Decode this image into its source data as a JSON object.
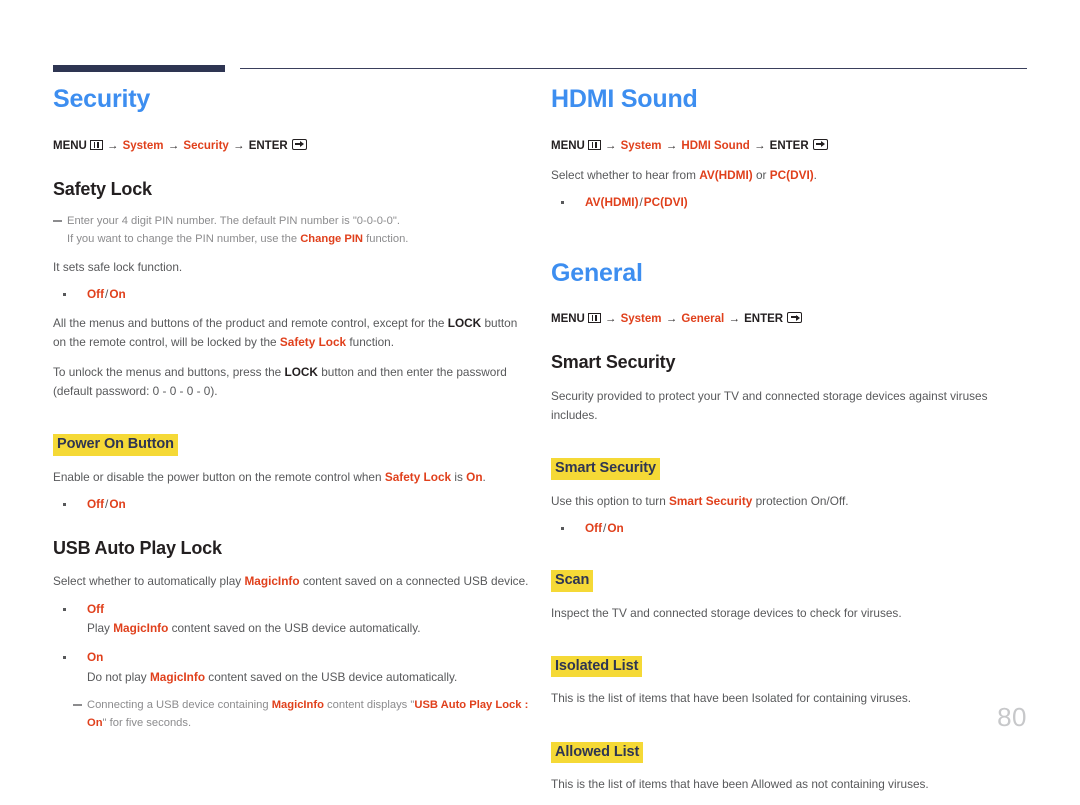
{
  "page": {
    "number": "80"
  },
  "icons": {
    "menu": "menu-icon",
    "enter": "enter-key-icon"
  },
  "left_column": {
    "section_title": "Security",
    "menu_path": {
      "menu_label": "MENU",
      "arrow": "→",
      "step1": "System",
      "step2": "Security",
      "enter_label": "ENTER"
    },
    "safety_lock": {
      "heading": "Safety Lock",
      "note_line1": "Enter your 4 digit PIN number. The default PIN number is \"0-0-0-0\".",
      "note_line2_pre": "If you want to change the PIN number, use the ",
      "note_line2_red": "Change PIN",
      "note_line2_post": " function.",
      "body1": "It sets safe lock function.",
      "option_off": "Off",
      "option_sep": "/",
      "option_on": "On",
      "body2_pre": "All the menus and buttons of the product and remote control, except for the ",
      "body2_lock": "LOCK",
      "body2_mid": " button on the remote control, will be locked by the ",
      "body2_red": "Safety Lock",
      "body2_post": " function.",
      "body3_pre": "To unlock the menus and buttons, press the ",
      "body3_lock": "LOCK",
      "body3_post": " button and then enter the password (default password: 0 - 0 - 0 - 0)."
    },
    "power_on_button": {
      "heading": "Power On Button",
      "body_pre": "Enable or disable the power button on the remote control when ",
      "body_red1": "Safety Lock",
      "body_mid": " is ",
      "body_red2": "On",
      "body_post": ".",
      "option_off": "Off",
      "option_sep": "/",
      "option_on": "On"
    },
    "usb_auto_play_lock": {
      "heading": "USB Auto Play Lock",
      "body_pre": "Select whether to automatically play ",
      "body_red": "MagicInfo",
      "body_post": " content saved on a connected USB device.",
      "options": [
        {
          "label": "Off",
          "desc_pre": "Play ",
          "desc_red": "MagicInfo",
          "desc_post": " content saved on the USB device automatically."
        },
        {
          "label": "On",
          "desc_pre": "Do not play ",
          "desc_red": "MagicInfo",
          "desc_post": " content saved on the USB device automatically."
        }
      ],
      "note_pre": "Connecting a USB device containing ",
      "note_red1": "MagicInfo",
      "note_mid": " content displays \"",
      "note_red2": "USB Auto Play Lock : On",
      "note_post": "\" for five seconds."
    }
  },
  "right_column": {
    "hdmi_sound": {
      "section_title": "HDMI Sound",
      "menu_path": {
        "menu_label": "MENU",
        "arrow": "→",
        "step1": "System",
        "step2": "HDMI Sound",
        "enter_label": "ENTER"
      },
      "body_pre": "Select whether to hear from ",
      "body_red1": "AV(HDMI)",
      "body_mid": " or ",
      "body_red2": "PC(DVI)",
      "body_post": ".",
      "option_av": "AV(HDMI)",
      "option_sep": "/",
      "option_pc": "PC(DVI)"
    },
    "general": {
      "section_title": "General",
      "menu_path": {
        "menu_label": "MENU",
        "arrow": "→",
        "step1": "System",
        "step2": "General",
        "enter_label": "ENTER"
      },
      "smart_security": {
        "heading": "Smart Security",
        "body": "Security provided to protect your TV and connected storage devices against viruses includes.",
        "sub_heading": "Smart Security",
        "sub_body_pre": "Use this option to turn ",
        "sub_body_red": "Smart Security",
        "sub_body_post": " protection On/Off.",
        "option_off": "Off",
        "option_sep": "/",
        "option_on": "On"
      },
      "scan": {
        "heading": "Scan",
        "body": "Inspect the TV and connected storage devices to check for viruses."
      },
      "isolated_list": {
        "heading": "Isolated List",
        "body": "This is the list of items that have been Isolated for containing viruses."
      },
      "allowed_list": {
        "heading": "Allowed List",
        "body": "This is the list of items that have been Allowed as not containing viruses."
      }
    }
  },
  "colors": {
    "accent_blue": "#3d8ef0",
    "accent_red": "#e0401c",
    "highlight_yellow": "#f5d936",
    "navy": "#2e3552",
    "body_gray": "#58595b"
  }
}
